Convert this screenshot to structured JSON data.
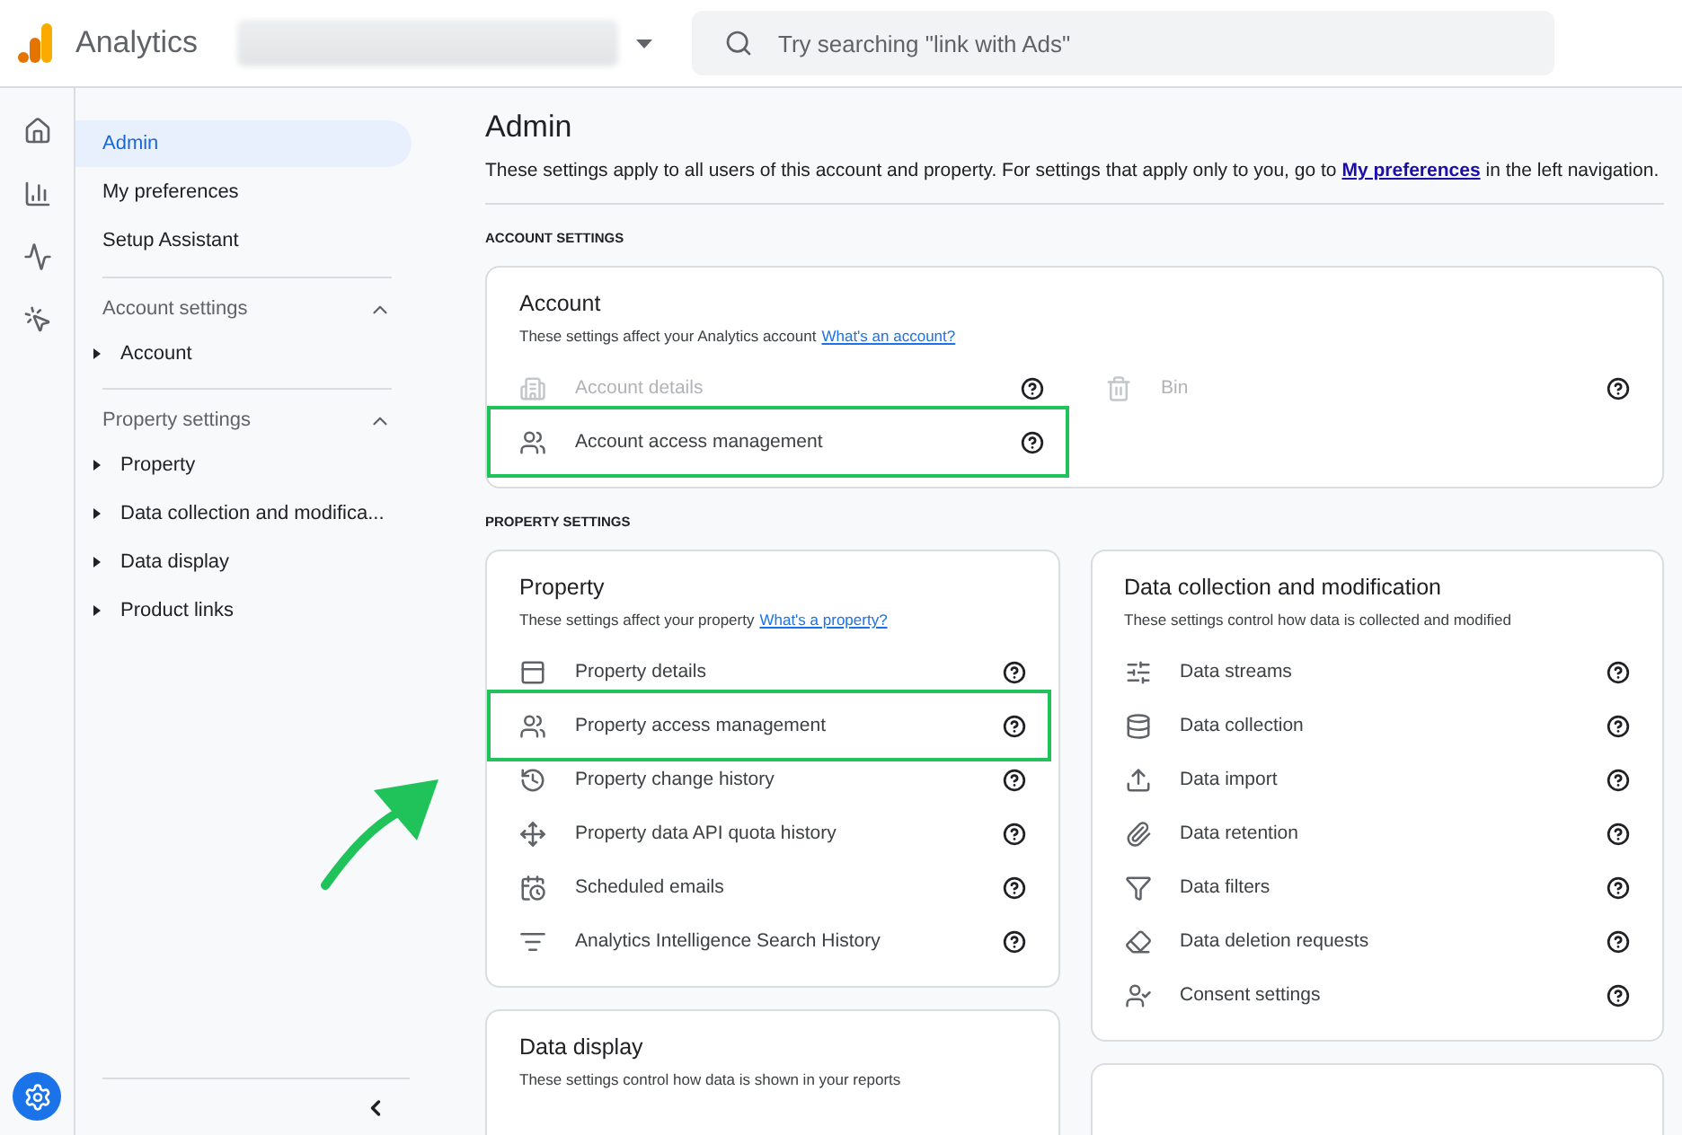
{
  "header": {
    "product": "Analytics",
    "search": {
      "placeholder": "Try searching \"link with Ads\""
    }
  },
  "nav": {
    "items": [
      {
        "label": "Admin",
        "selected": true
      },
      {
        "label": "My preferences",
        "selected": false
      },
      {
        "label": "Setup Assistant",
        "selected": false
      }
    ],
    "sections": [
      {
        "label": "Account settings",
        "expanded": true,
        "children": [
          {
            "label": "Account",
            "expanded": false
          }
        ]
      },
      {
        "label": "Property settings",
        "expanded": true,
        "children": [
          {
            "label": "Property",
            "expanded": false
          },
          {
            "label": "Data collection and modifica...",
            "expanded": false
          },
          {
            "label": "Data display",
            "expanded": false
          },
          {
            "label": "Product links",
            "expanded": false
          }
        ]
      }
    ]
  },
  "main": {
    "title": "Admin",
    "intro": {
      "before": "These settings apply to all users of this account and property. For settings that apply only to you, go to",
      "link": "My preferences",
      "after": "in the left navigation."
    },
    "sections": [
      {
        "heading": "ACCOUNT SETTINGS",
        "columns": [
          [
            {
              "title": "Account",
              "description": "These settings affect your Analytics account",
              "link": "What's an account?",
              "item_columns": [
                [
                  {
                    "label": "Account details",
                    "disabled": true,
                    "highlighted": false
                  },
                  {
                    "label": "Account access management",
                    "disabled": false,
                    "highlighted": true
                  }
                ],
                [
                  {
                    "label": "Bin",
                    "disabled": true,
                    "highlighted": false
                  }
                ]
              ]
            }
          ]
        ]
      },
      {
        "heading": "PROPERTY SETTINGS",
        "columns": [
          [
            {
              "title": "Property",
              "description": "These settings affect your property",
              "link": "What's a property?",
              "item_columns": [
                [
                  {
                    "label": "Property details",
                    "disabled": false,
                    "highlighted": false
                  },
                  {
                    "label": "Property access management",
                    "disabled": false,
                    "highlighted": true
                  },
                  {
                    "label": "Property change history",
                    "disabled": false,
                    "highlighted": false
                  },
                  {
                    "label": "Property data API quota history",
                    "disabled": false,
                    "highlighted": false
                  },
                  {
                    "label": "Scheduled emails",
                    "disabled": false,
                    "highlighted": false
                  },
                  {
                    "label": "Analytics Intelligence Search History",
                    "disabled": false,
                    "highlighted": false
                  }
                ]
              ]
            },
            {
              "title": "Data display",
              "description": "These settings control how data is shown in your reports"
            }
          ],
          [
            {
              "title": "Data collection and modification",
              "description": "These settings control how data is collected and modified",
              "item_columns": [
                [
                  {
                    "label": "Data streams",
                    "disabled": false,
                    "highlighted": false
                  },
                  {
                    "label": "Data collection",
                    "disabled": false,
                    "highlighted": false
                  },
                  {
                    "label": "Data import",
                    "disabled": false,
                    "highlighted": false
                  },
                  {
                    "label": "Data retention",
                    "disabled": false,
                    "highlighted": false
                  },
                  {
                    "label": "Data filters",
                    "disabled": false,
                    "highlighted": false
                  },
                  {
                    "label": "Data deletion requests",
                    "disabled": false,
                    "highlighted": false
                  },
                  {
                    "label": "Consent settings",
                    "disabled": false,
                    "highlighted": false
                  }
                ]
              ]
            },
            {}
          ]
        ]
      }
    ]
  }
}
